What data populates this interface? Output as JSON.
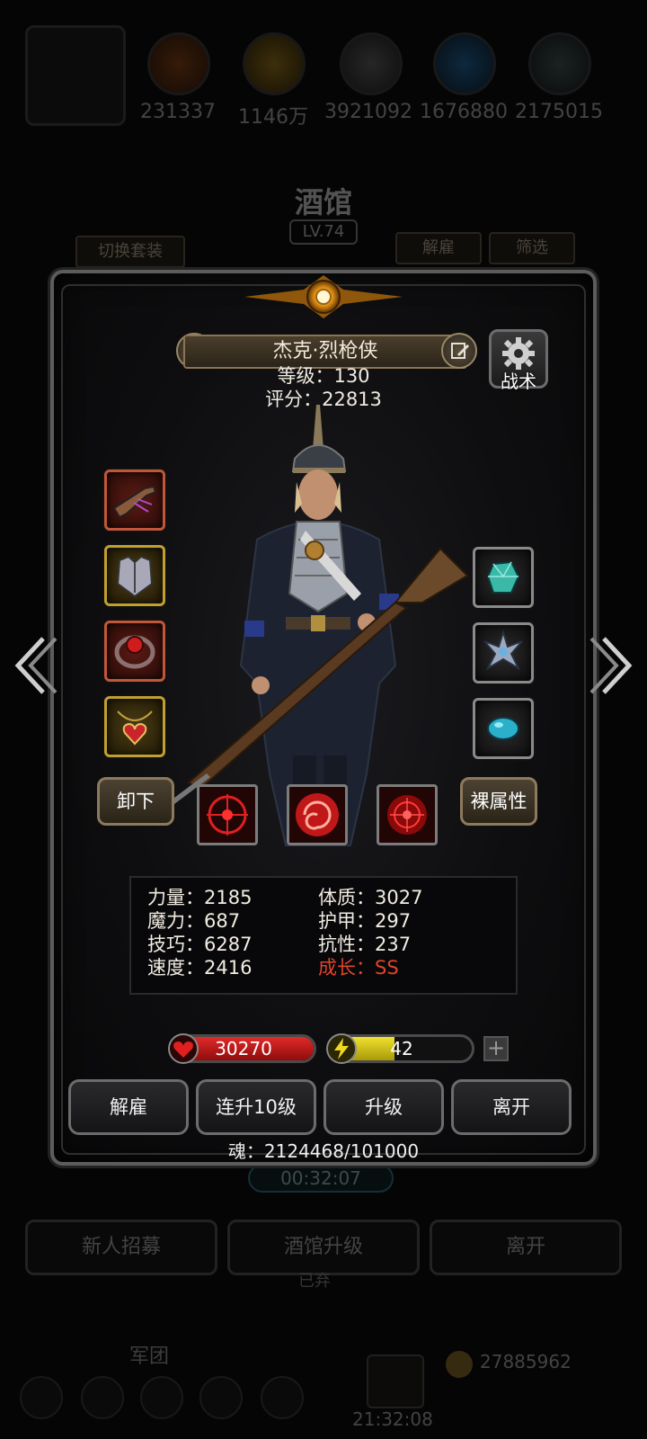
{
  "background": {
    "resources": [
      "231337",
      "1146万",
      "3921092",
      "1676880",
      "2175015"
    ],
    "title": "酒馆",
    "level": "LV.74",
    "switch_set_label": "切换套装",
    "dismiss_label": "解雇",
    "filter_label": "筛选",
    "timer": "00:32:07",
    "recruit_label": "新人招募",
    "upgrade_tavern_label": "酒馆升级",
    "leave_label": "离开",
    "faded_text": "已弃",
    "legion_label": "军团",
    "clock": "21:32:08",
    "gold": "27885962"
  },
  "hero": {
    "name": "杰克·烈枪侠",
    "level_line": "等级：130",
    "score_line": "评分：22813",
    "tactic_label": "战术"
  },
  "buttons": {
    "unequip": "卸下",
    "naked_attr": "裸属性"
  },
  "attributes": {
    "left": [
      "力量：2185",
      "魔力：687",
      "技巧：6287",
      "速度：2416"
    ],
    "right": [
      "体质：3027",
      "护甲：297",
      "抗性：237"
    ],
    "growth": "成长：SS"
  },
  "bars": {
    "hp": "30270",
    "energy": "42",
    "hp_fill": 1.0,
    "energy_fill": 0.45
  },
  "actions": {
    "dismiss": "解雇",
    "level_up_10": "连升10级",
    "level_up": "升级",
    "leave": "离开"
  },
  "soul": "魂：2124468/101000",
  "colors": {
    "hp": "#c81c1c",
    "energy": "#d8c81c",
    "growth": "#e0442a",
    "frame": "#5c5c5c"
  },
  "icons": {
    "equipment_left": [
      "flintlock-pistol-icon",
      "chest-armor-icon",
      "red-gem-ring-icon",
      "heart-necklace-icon"
    ],
    "equipment_right": [
      "teal-crystal-icon",
      "silver-emblem-icon",
      "blue-stone-icon"
    ],
    "skills": [
      "crosshair-skill-icon",
      "vortex-skill-icon",
      "target-skill-icon"
    ]
  }
}
